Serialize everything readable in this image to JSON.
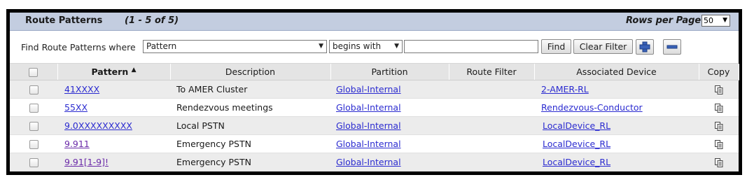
{
  "header": {
    "title": "Route Patterns",
    "count": "(1 - 5 of 5)",
    "rows_per_page_label": "Rows per Page",
    "rows_per_page_value": "50"
  },
  "find": {
    "label": "Find Route Patterns where",
    "field": "Pattern",
    "operator": "begins with",
    "value": "",
    "find_button": "Find",
    "clear_button": "Clear Filter",
    "add_icon": "plus-icon",
    "remove_icon": "minus-icon"
  },
  "table": {
    "columns": [
      "Pattern",
      "Description",
      "Partition",
      "Route Filter",
      "Associated Device",
      "Copy"
    ],
    "sort_indicator": "▲",
    "rows": [
      {
        "pattern": "41XXXX",
        "description": "To AMER Cluster",
        "partition": "Global-Internal",
        "route_filter": "",
        "device": "2-AMER-RL"
      },
      {
        "pattern": "55XX",
        "description": "Rendezvous meetings",
        "partition": "Global-Internal",
        "route_filter": "",
        "device": "Rendezvous-Conductor"
      },
      {
        "pattern": "9.0XXXXXXXXX",
        "description": "Local PSTN",
        "partition": "Global-Internal",
        "route_filter": "",
        "device": "LocalDevice_RL"
      },
      {
        "pattern": "9.911",
        "description": "Emergency PSTN",
        "partition": "Global-Internal",
        "route_filter": "",
        "device": "LocalDevice_RL"
      },
      {
        "pattern": "9.91[1-9]!",
        "description": "Emergency PSTN",
        "partition": "Global-Internal",
        "route_filter": "",
        "device": "LocalDevice_RL"
      }
    ]
  },
  "colors": {
    "header_bg": "#c3cde0",
    "link": "#2b2bd0",
    "visited_link": "#6a2aa8"
  }
}
